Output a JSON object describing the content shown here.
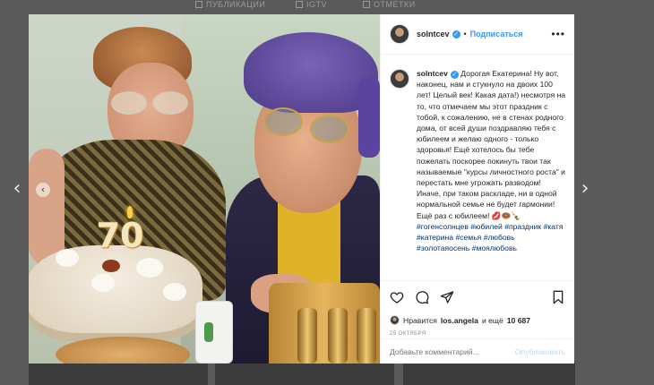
{
  "background": {
    "tabs": [
      "ПУБЛИКАЦИИ",
      "IGTV",
      "ОТМЕТКИ"
    ]
  },
  "colors": {
    "accent": "#3897f0",
    "hashtag": "#003569",
    "muted": "#8e8e8e"
  },
  "icons": {
    "prev": "chevron-left-icon",
    "next": "chevron-right-icon",
    "more": "more-options-icon",
    "like": "heart-icon",
    "comment": "comment-icon",
    "share": "share-icon",
    "save": "bookmark-icon"
  },
  "post": {
    "username": "solntcev",
    "follow_label": "Подписаться",
    "caption_text": "Дорогая Екатерина! Ну вот, наконец, нам и стукнуло на двоих 100 лет! Целый век! Какая дата!) несмотря на то, что отмечаем мы этот праздник с тобой, к сожалению, не в стенах родного дома, от всей души поздравляю тебя с юбилеем и желаю одного - только здоровья! Ещё хотелось бы тебе пожелать поскорее покинуть твои так называемые \"курсы личностного роста\" и перестать мне угрожать разводом! Иначе, при таком раскладе, ни в одной нормальной семье не будет гармонии! Ещё раз с юбилеем!",
    "caption_emoji": "💋🍩🍾",
    "hashtags": [
      "#гогенсолнцев",
      "#юбилей",
      "#праздник",
      "#катя",
      "#катерина",
      "#семья",
      "#любовь",
      "#золотаяосень",
      "#моялюбовь"
    ],
    "likes_prefix": "Нравится",
    "likes_user": "los.angela",
    "likes_and": "и ещё",
    "likes_count": "10 687",
    "date": "25 ОКТЯБРЯ",
    "comment_placeholder": "Добавьте комментарий...",
    "publish_label": "Опубликовать",
    "cake_number": "70"
  }
}
